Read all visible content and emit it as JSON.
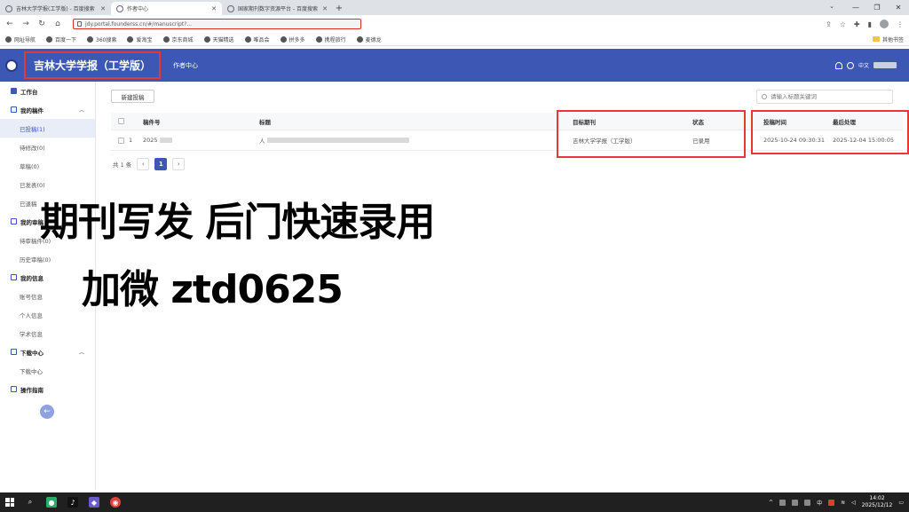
{
  "browser": {
    "tabs": [
      {
        "title": "吉林大学学报(工学版) - 百度搜索",
        "active": false
      },
      {
        "title": "作者中心",
        "active": true
      },
      {
        "title": "国家期刊数字资源平台 - 百度搜索",
        "active": false
      }
    ],
    "new_tab": "+",
    "url": "jdy.portal.founderss.cn/#/manuscript?...",
    "bookmarks": [
      "网址导航",
      "百度一下",
      "360搜索",
      "爱淘宝",
      "京东商城",
      "天猫精选",
      "唯品会",
      "拼多多",
      "携程旅行",
      "麦德龙"
    ],
    "bookmark_folder": "其他书签"
  },
  "header": {
    "brand": "吉林大学学报（工学版）",
    "nav": "作者中心",
    "lang": "中文"
  },
  "sidebar": {
    "workspace": "工作台",
    "manuscripts_group": "我的稿件",
    "manuscripts_items": [
      "已投稿(1)",
      "待修改(0)",
      "草稿(0)",
      "已发表(0)",
      "已退稿"
    ],
    "review_group": "我的审稿",
    "review_items": [
      "待审稿件(0)",
      "历史审稿(0)"
    ],
    "info_group": "我的信息",
    "info_items": [
      "账号信息",
      "个人信息",
      "学术信息"
    ],
    "download_group": "下载中心",
    "download_items": [
      "下载中心"
    ],
    "guide": "操作指南"
  },
  "main": {
    "new_button": "新建投稿",
    "search_placeholder": "请输入标题关键词",
    "columns": [
      "稿件号",
      "标题",
      "目标期刊",
      "状态",
      "投稿时间",
      "最后处理"
    ],
    "rows": [
      {
        "index": "1",
        "manuscript_no": "2025",
        "title": "人",
        "journal": "吉林大学学报（工学版）",
        "status": "已录用",
        "submit_time": "2025-10-24 09:30:31",
        "last_processed": "2025-12-04 15:00:05"
      }
    ],
    "pager": {
      "total": "共 1 条",
      "current_page": "1",
      "prev": "‹",
      "next": "›"
    }
  },
  "overlay": {
    "line1": "期刊写发 后门快速录用",
    "line2": "加微 ztd0625"
  },
  "taskbar": {
    "time": "14:02",
    "date": "2025/12/12",
    "ime": "中"
  }
}
